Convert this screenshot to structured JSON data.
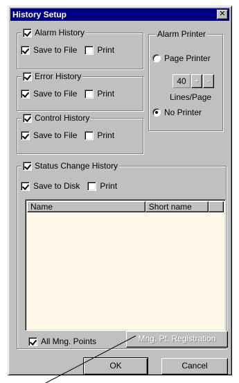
{
  "window": {
    "title": "History Setup",
    "close_glyph": "✕"
  },
  "alarm_history": {
    "label": "Alarm History",
    "checked": true,
    "save_label": "Save to File",
    "save_checked": true,
    "print_label": "Print",
    "print_checked": false
  },
  "error_history": {
    "label": "Error History",
    "checked": true,
    "save_label": "Save to File",
    "save_checked": true,
    "print_label": "Print",
    "print_checked": false
  },
  "control_history": {
    "label": "Control History",
    "checked": true,
    "save_label": "Save to File",
    "save_checked": true,
    "print_label": "Print",
    "print_checked": false
  },
  "alarm_printer": {
    "label": "Alarm Printer",
    "page_printer_label": "Page Printer",
    "page_printer_selected": false,
    "lines_value": "40",
    "plus": "+",
    "minus": "-",
    "lines_label": "Lines/Page",
    "no_printer_label": "No Printer",
    "no_printer_selected": true
  },
  "status_change_history": {
    "label": "Status Change History",
    "checked": true,
    "save_label": "Save to Disk",
    "save_checked": true,
    "print_label": "Print",
    "print_checked": false,
    "columns": [
      "Name",
      "Short name"
    ],
    "rows": []
  },
  "footer": {
    "all_points_label": "All Mng. Points",
    "all_points_checked": true,
    "registration_button": "Mng. Pt. Registration",
    "ok_button": "OK",
    "cancel_button": "Cancel"
  },
  "colors": {
    "titlebar": "#000080",
    "face": "#c0c0c0",
    "list_background": "#fff8e8"
  }
}
